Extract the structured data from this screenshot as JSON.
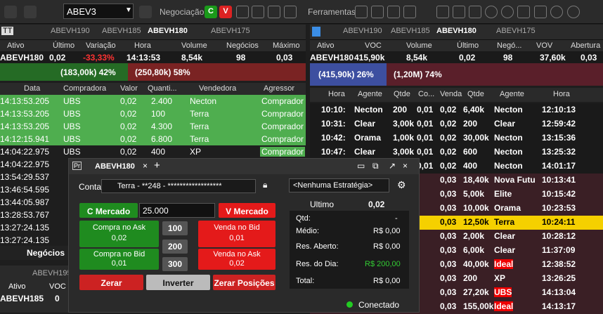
{
  "toolbar": {
    "ticker": "ABEV3",
    "negociacao": "Negociação",
    "ferramentas": "Ferramentas",
    "c": "C",
    "v": "V"
  },
  "left_tabs": [
    "ABEVH190",
    "ABEVH185",
    "ABEVH180",
    "ABEVH175"
  ],
  "right_tabs": [
    "ABEVH190",
    "ABEVH185",
    "ABEVH180",
    "ABEVH175"
  ],
  "left_quote": {
    "cols": [
      "Ativo",
      "Último",
      "Variação",
      "Hora",
      "Volume",
      "Negócios",
      "Máximo"
    ],
    "vals": [
      "ABEVH180",
      "0,02",
      "-33,33%",
      "14:13:53",
      "8,54k",
      "98",
      "0,03"
    ]
  },
  "right_quote": {
    "cols": [
      "Ativo",
      "VOC",
      "Volume",
      "Último",
      "Negó...",
      "VOV",
      "Abertura"
    ],
    "vals": [
      "ABEVH180",
      "415,90k",
      "8,54k",
      "0,02",
      "98",
      "37,60k",
      "0,03"
    ]
  },
  "left_bar": {
    "buy": "(183,00k) 42%",
    "sell": "(250,80k) 58%"
  },
  "right_bar": {
    "buy": "(415,90k) 26%",
    "sell": "(1,20M) 74%"
  },
  "trades": {
    "cols": [
      "Data",
      "Compradora",
      "Valor",
      "Quanti...",
      "Vendedora",
      "Agressor"
    ],
    "rows": [
      [
        "14:13:53.205",
        "UBS",
        "0,02",
        "2.400",
        "Necton",
        "Comprador"
      ],
      [
        "14:13:53.205",
        "UBS",
        "0,02",
        "100",
        "Terra",
        "Comprador"
      ],
      [
        "14:13:53.205",
        "UBS",
        "0,02",
        "4.300",
        "Terra",
        "Comprador"
      ],
      [
        "14:12:15.941",
        "UBS",
        "0,02",
        "6.800",
        "Terra",
        "Comprador"
      ],
      [
        "14:04:22.975",
        "UBS",
        "0,02",
        "400",
        "XP",
        "Comprador"
      ],
      [
        "14:04:22.975",
        "",
        "",
        "",
        "",
        ""
      ],
      [
        "13:54:29.537",
        "",
        "",
        "",
        "",
        ""
      ],
      [
        "13:46:54.595",
        "",
        "",
        "",
        "",
        ""
      ],
      [
        "13:44:05.987",
        "",
        "",
        "",
        "",
        ""
      ],
      [
        "13:28:53.767",
        "",
        "",
        "",
        "",
        ""
      ],
      [
        "13:27:24.135",
        "",
        "",
        "",
        "",
        ""
      ],
      [
        "13:27:24.135",
        "",
        "",
        "",
        "",
        ""
      ]
    ],
    "tab": "Negócios"
  },
  "book": {
    "cols": [
      "Hora",
      "Agente",
      "Qtde",
      "Co...",
      "Venda",
      "Qtde",
      "Agente",
      "Hora"
    ],
    "buy": [
      [
        "10:10:",
        "Necton",
        "200",
        "0,01"
      ],
      [
        "10:31:",
        "Clear",
        "3,00k",
        "0,01"
      ],
      [
        "10:42:",
        "Orama",
        "1,00k",
        "0,01"
      ],
      [
        "10:47:",
        "Clear",
        "3,00k",
        "0,01"
      ],
      [
        "",
        "",
        "",
        "0,01"
      ]
    ],
    "sell": [
      [
        "0,02",
        "6,40k",
        "Necton",
        "12:10:13"
      ],
      [
        "0,02",
        "200",
        "Clear",
        "12:59:42"
      ],
      [
        "0,02",
        "30,00k",
        "Necton",
        "13:15:36"
      ],
      [
        "0,02",
        "600",
        "Necton",
        "13:25:32"
      ],
      [
        "0,02",
        "400",
        "Necton",
        "14:01:17"
      ],
      [
        "0,03",
        "18,40k",
        "Nova Futu",
        "10:13:41"
      ],
      [
        "0,03",
        "5,00k",
        "Elite",
        "10:15:42"
      ],
      [
        "0,03",
        "10,00k",
        "Orama",
        "10:23:53"
      ],
      [
        "0,03",
        "12,50k",
        "Terra",
        "10:24:11"
      ],
      [
        "0,03",
        "2,00k",
        "Clear",
        "10:28:12"
      ],
      [
        "0,03",
        "6,00k",
        "Clear",
        "11:37:09"
      ],
      [
        "0,03",
        "40,00k",
        "Ideal",
        "12:38:52"
      ],
      [
        "0,03",
        "200",
        "XP",
        "13:26:25"
      ],
      [
        "0,03",
        "27,20k",
        "UBS",
        "14:13:04"
      ],
      [
        "0,03",
        "155,00k",
        "Ideal",
        "14:13:17"
      ]
    ]
  },
  "small": {
    "tab": "ABEVH195",
    "cols": [
      "Ativo",
      "VOC"
    ],
    "vals": [
      "ABEVH185",
      "0"
    ]
  },
  "order": {
    "title": "ABEVH180",
    "conta_label": "Conta",
    "conta": "Terra - **248 - ******************",
    "estrategia": "<Nenhuma Estratégia>",
    "c_mercado": "C Mercado",
    "qty": "25.000",
    "v_mercado": "V Mercado",
    "compra_ask": "Compra no Ask",
    "compra_ask_v": "0,02",
    "venda_bid": "Venda no Bid",
    "venda_bid_v": "0,01",
    "compra_bid": "Compra no Bid",
    "compra_bid_v": "0,01",
    "venda_ask": "Venda no Ask",
    "venda_ask_v": "0,02",
    "q100": "100",
    "q200": "200",
    "q300": "300",
    "zerar": "Zerar",
    "inverter": "Inverter",
    "zerar_pos": "Zerar Posições",
    "ultimo_l": "Ultimo",
    "ultimo": "0,02",
    "qtd_l": "Qtd:",
    "qtd": "-",
    "medio_l": "Médio:",
    "medio": "R$ 0,00",
    "aberto_l": "Res. Aberto:",
    "aberto": "R$ 0,00",
    "dia_l": "Res. do Dia:",
    "dia": "R$ 200,00",
    "total_l": "Total:",
    "total": "R$ 0,00",
    "status": "Conectado"
  }
}
